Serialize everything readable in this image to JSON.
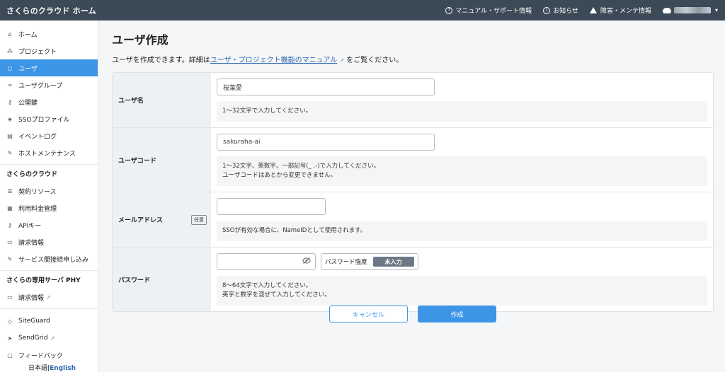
{
  "header": {
    "brand": "さくらのクラウド ホーム",
    "links": [
      {
        "label": "マニュアル・サポート情報",
        "icon": "help-icon"
      },
      {
        "label": "お知らせ",
        "icon": "info-icon"
      },
      {
        "label": "障害・メンテ情報",
        "icon": "warning-icon"
      }
    ]
  },
  "sidebar": {
    "items": [
      {
        "label": "ホーム",
        "icon": "home-icon"
      },
      {
        "label": "プロジェクト",
        "icon": "project-icon"
      },
      {
        "label": "ユーザ",
        "icon": "user-icon",
        "active": true
      },
      {
        "label": "ユーザグループ",
        "icon": "user-group-icon"
      },
      {
        "label": "公開鍵",
        "icon": "key-icon"
      },
      {
        "label": "SSOプロファイル",
        "icon": "shield-icon"
      },
      {
        "label": "イベントログ",
        "icon": "log-icon"
      },
      {
        "label": "ホストメンテナンス",
        "icon": "wrench-icon"
      }
    ],
    "section_cloud": "さくらのクラウド",
    "cloud_items": [
      {
        "label": "契約リソース",
        "icon": "list-icon"
      },
      {
        "label": "利用料金管理",
        "icon": "billing-icon"
      },
      {
        "label": "APIキー",
        "icon": "api-key-icon"
      },
      {
        "label": "請求情報",
        "icon": "invoice-icon"
      },
      {
        "label": "サービス間接続申し込み",
        "icon": "connect-icon"
      }
    ],
    "section_phy": "さくらの専用サーバ PHY",
    "phy_items": [
      {
        "label": "請求情報",
        "icon": "invoice-icon",
        "external": true
      }
    ],
    "other_items": [
      {
        "label": "SiteGuard",
        "icon": "siteguard-icon"
      },
      {
        "label": "SendGrid",
        "icon": "send-icon",
        "external": true
      },
      {
        "label": "フィードバック",
        "icon": "feedback-icon"
      }
    ],
    "lang_ja": "日本語",
    "lang_sep": "|",
    "lang_en": "English"
  },
  "page": {
    "title": "ユーザ作成",
    "desc_prefix": "ユーザを作成できます。詳細は",
    "desc_link": "ユーザ・プロジェクト機能のマニュアル",
    "desc_suffix": "をご覧ください。"
  },
  "form": {
    "username": {
      "label": "ユーザ名",
      "value": "桜葉愛",
      "hint": "1〜32文字で入力してください。"
    },
    "usercode": {
      "label": "ユーザコード",
      "value": "sakuraha-ai",
      "hint1": "1〜32文字、英数字、一部記号(_ .-)で入力してください。",
      "hint2": "ユーザコードはあとから変更できません。"
    },
    "email": {
      "label": "メールアドレス",
      "optional": "任意",
      "value": "",
      "hint": "SSOが有効な場合に、NameIDとして使用されます。"
    },
    "password": {
      "label": "パスワード",
      "value": "",
      "strength_label": "パスワード強度",
      "strength_value": "未入力",
      "hint1": "8〜64文字で入力してください。",
      "hint2": "英字と数字を混ぜて入力してください。"
    }
  },
  "actions": {
    "cancel": "キャンセル",
    "create": "作成"
  },
  "colors": {
    "accent": "#3d95e8",
    "topbar": "#3c4a57"
  }
}
